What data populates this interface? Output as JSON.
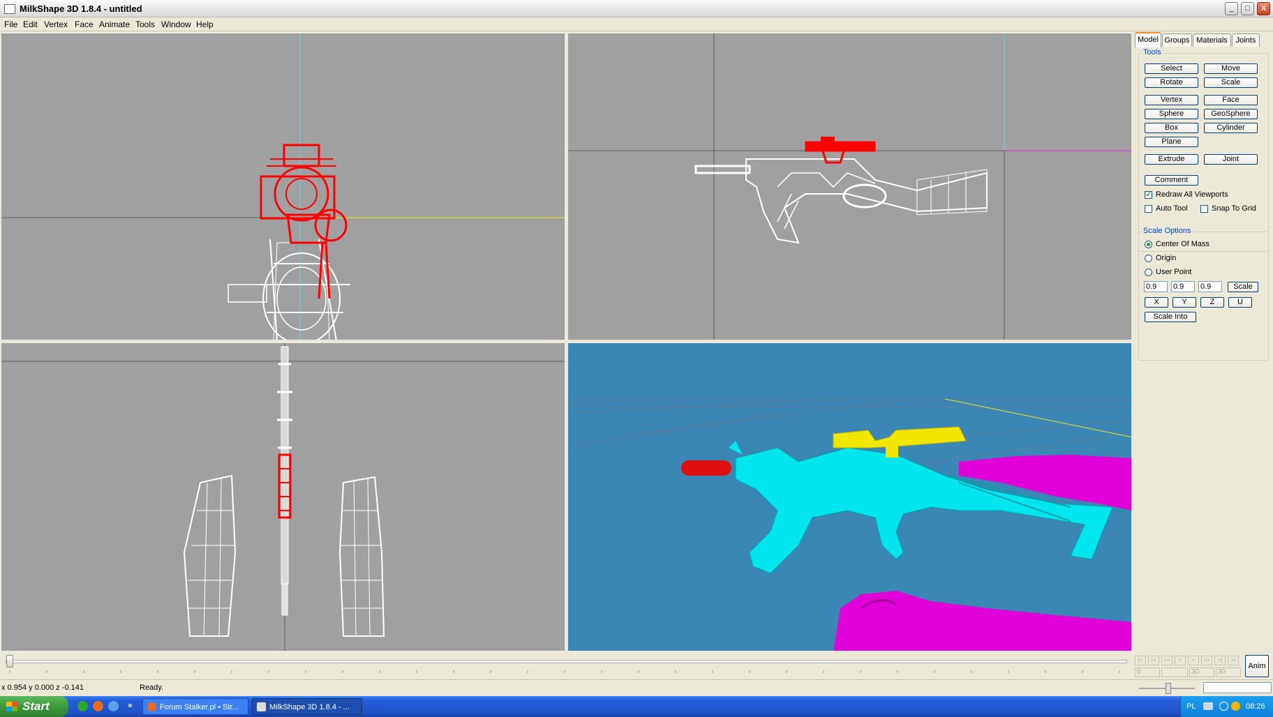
{
  "window": {
    "title": "MilkShape 3D 1.8.4 - untitled",
    "controls": {
      "minimize": "_",
      "maximize": "□",
      "close": "X"
    }
  },
  "menu": [
    "File",
    "Edit",
    "Vertex",
    "Face",
    "Animate",
    "Tools",
    "Window",
    "Help"
  ],
  "tabs": [
    "Model",
    "Groups",
    "Materials",
    "Joints"
  ],
  "tools": {
    "label": "Tools",
    "buttons": {
      "select": "Select",
      "move": "Move",
      "rotate": "Rotate",
      "scale": "Scale",
      "vertex": "Vertex",
      "face": "Face",
      "sphere": "Sphere",
      "geosphere": "GeoSphere",
      "box": "Box",
      "cylinder": "Cylinder",
      "plane": "Plane",
      "extrude": "Extrude",
      "joint": "Joint",
      "comment": "Comment"
    },
    "checkboxes": {
      "redraw_all_viewports": {
        "label": "Redraw All Viewports",
        "checked": true
      },
      "auto_tool": {
        "label": "Auto Tool",
        "checked": false
      },
      "snap_to_grid": {
        "label": "Snap To Grid",
        "checked": false
      }
    }
  },
  "scale_options": {
    "label": "Scale Options",
    "radios": {
      "center_of_mass": "Center Of Mass",
      "origin": "Origin",
      "user_point": "User Point"
    },
    "selected": "center_of_mass",
    "values": [
      "0.9",
      "0.9",
      "0.9"
    ],
    "scale_button": "Scale",
    "axis_buttons": [
      "X",
      "Y",
      "Z",
      "U"
    ],
    "scale_into": "Scale Into"
  },
  "timeline": {
    "frame_start": "0",
    "frame_current": "30",
    "frame_end": "30",
    "anim_button": "Anim"
  },
  "status": {
    "coords": "x 0.954 y 0.000 z -0.141",
    "message": "Ready."
  },
  "taskbar": {
    "start": "Start",
    "tasks": [
      "Forum Stalker.pl • Str...",
      "MilkShape 3D 1.8.4 - ..."
    ],
    "language": "PL",
    "time": "08:26"
  },
  "colors": {
    "viewport_bg": "#a0a0a0",
    "perspective_bg": "#3a86b4",
    "wire_selected": "#ff0000",
    "wire_default": "#ffffff",
    "gun_body": "#00e5ee",
    "scope": "#f0e600",
    "silencer": "#e01010",
    "hands": "#e000d8"
  }
}
